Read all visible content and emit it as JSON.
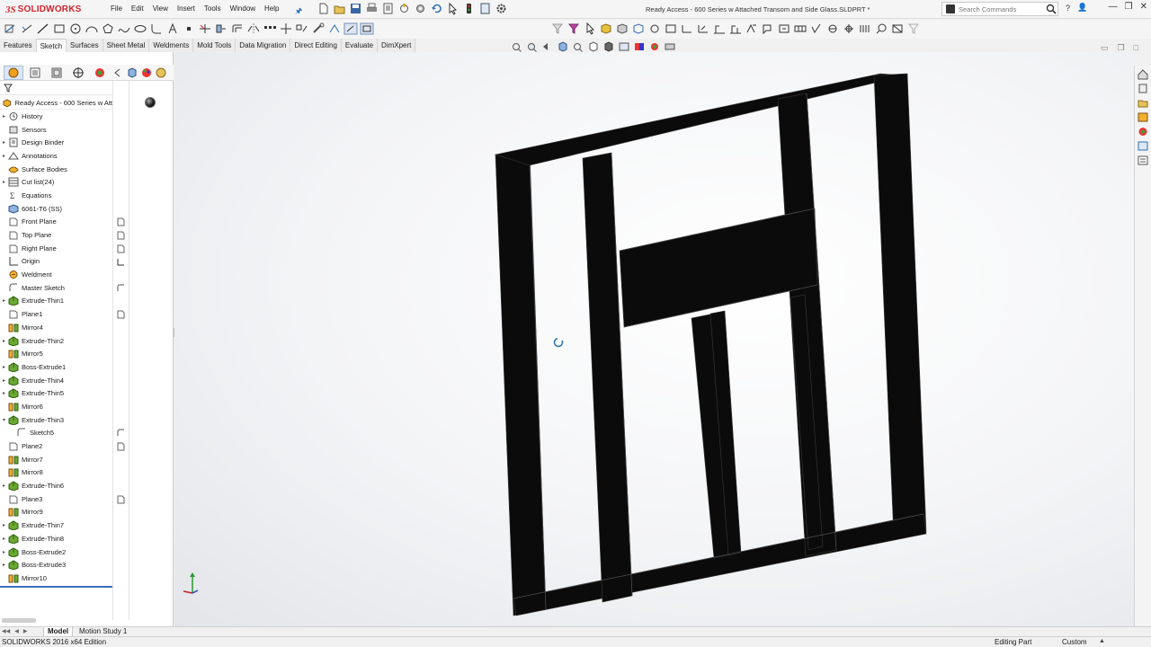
{
  "app": {
    "logo_ds": "3S",
    "logo_name": "SOLIDWORKS",
    "window_title": "Ready Access - 600 Series w Attached Transom and Side Glass.SLDPRT *"
  },
  "menu": [
    "File",
    "Edit",
    "View",
    "Insert",
    "Tools",
    "Window",
    "Help"
  ],
  "search": {
    "placeholder": "Search Commands"
  },
  "tabs": [
    "Features",
    "Sketch",
    "Surfaces",
    "Sheet Metal",
    "Weldments",
    "Mold Tools",
    "Data Migration",
    "Direct Editing",
    "Evaluate",
    "DimXpert"
  ],
  "active_tab": "Sketch",
  "tree": {
    "root": "Ready Access - 600 Series w Att",
    "items": [
      {
        "label": "History",
        "icon": "history-icon",
        "expandable": true
      },
      {
        "label": "Sensors",
        "icon": "sensor-icon",
        "expandable": false
      },
      {
        "label": "Design Binder",
        "icon": "design-binder-icon",
        "expandable": true
      },
      {
        "label": "Annotations",
        "icon": "annotations-icon",
        "expandable": true
      },
      {
        "label": "Surface Bodies",
        "icon": "surface-bodies-icon",
        "expandable": false
      },
      {
        "label": "Cut list(24)",
        "icon": "cut-list-icon",
        "expandable": true
      },
      {
        "label": "Equations",
        "icon": "equations-icon",
        "expandable": false
      },
      {
        "label": "6061-T6 (SS)",
        "icon": "material-icon",
        "expandable": false
      },
      {
        "label": "Front Plane",
        "icon": "plane-icon",
        "expandable": false
      },
      {
        "label": "Top Plane",
        "icon": "plane-icon",
        "expandable": false
      },
      {
        "label": "Right Plane",
        "icon": "plane-icon",
        "expandable": false
      },
      {
        "label": "Origin",
        "icon": "origin-icon",
        "expandable": false
      },
      {
        "label": "Weldment",
        "icon": "weldment-icon",
        "expandable": false
      },
      {
        "label": "Master Sketch",
        "icon": "sketch-icon",
        "expandable": false
      },
      {
        "label": "Extrude-Thin1",
        "icon": "extrude-icon",
        "expandable": true
      },
      {
        "label": "Plane1",
        "icon": "plane-icon",
        "expandable": false
      },
      {
        "label": "Mirror4",
        "icon": "mirror-icon",
        "expandable": false
      },
      {
        "label": "Extrude-Thin2",
        "icon": "extrude-icon",
        "expandable": true
      },
      {
        "label": "Mirror5",
        "icon": "mirror-icon",
        "expandable": false
      },
      {
        "label": "Boss-Extrude1",
        "icon": "extrude-icon",
        "expandable": true
      },
      {
        "label": "Extrude-Thin4",
        "icon": "extrude-icon",
        "expandable": true
      },
      {
        "label": "Extrude-Thin5",
        "icon": "extrude-icon",
        "expandable": true
      },
      {
        "label": "Mirror6",
        "icon": "mirror-icon",
        "expandable": false
      },
      {
        "label": "Extrude-Thin3",
        "icon": "extrude-icon",
        "expandable": true,
        "expanded": true
      },
      {
        "label": "Sketch5",
        "icon": "sketch-icon",
        "expandable": false,
        "child": true
      },
      {
        "label": "Plane2",
        "icon": "plane-icon",
        "expandable": false
      },
      {
        "label": "Mirror7",
        "icon": "mirror-icon",
        "expandable": false
      },
      {
        "label": "Mirror8",
        "icon": "mirror-icon",
        "expandable": false
      },
      {
        "label": "Extrude-Thin6",
        "icon": "extrude-icon",
        "expandable": true
      },
      {
        "label": "Plane3",
        "icon": "plane-icon",
        "expandable": false
      },
      {
        "label": "Mirror9",
        "icon": "mirror-icon",
        "expandable": false
      },
      {
        "label": "Extrude-Thin7",
        "icon": "extrude-icon",
        "expandable": true
      },
      {
        "label": "Extrude-Thin8",
        "icon": "extrude-icon",
        "expandable": true
      },
      {
        "label": "Boss-Extrude2",
        "icon": "extrude-icon",
        "expandable": true
      },
      {
        "label": "Boss-Extrude3",
        "icon": "extrude-icon",
        "expandable": true
      },
      {
        "label": "Mirror10",
        "icon": "mirror-icon",
        "expandable": false
      }
    ]
  },
  "bottom_tabs": {
    "model": "Model",
    "motion": "Motion Study 1"
  },
  "status": {
    "left": "SOLIDWORKS 2016 x64 Edition",
    "mode": "Editing Part",
    "units": "Custom"
  },
  "colors": {
    "brand": "#d2232a",
    "accent": "#2d6fb6",
    "model_body": "#0d0d0d",
    "feature_green": "#6aa832"
  }
}
